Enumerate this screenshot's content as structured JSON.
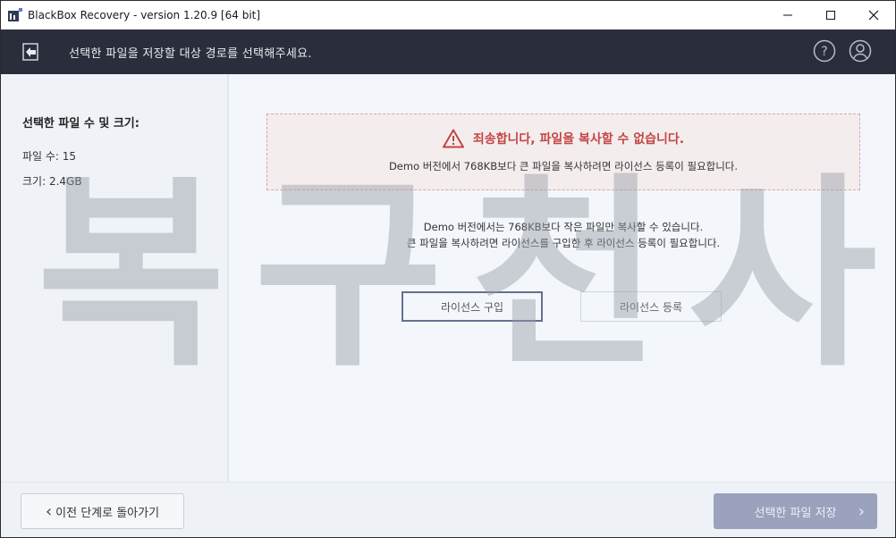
{
  "window": {
    "title": "BlackBox Recovery - version 1.20.9 [64 bit]"
  },
  "controls": {
    "minimize": "—",
    "maximize": "☐",
    "close": "✕"
  },
  "header": {
    "instruction": "선택한 파일을 저장할 대상 경로를 선택해주세요."
  },
  "left_panel": {
    "title": "선택한 파일 수 및 크기:",
    "file_count": "파일 수: 15",
    "size": "크기: 2.4GB"
  },
  "error": {
    "title": "죄송합니다, 파일을 복사할 수 없습니다.",
    "message": "Demo 버전에서 768KB보다 큰 파일을 복사하려면 라이선스 등록이 필요합니다."
  },
  "info": {
    "line1": "Demo 버전에서는 768KB보다 작은 파일만 복사할 수 있습니다.",
    "line2": "큰 파일을 복사하려면 라이선스를 구입한 후 라이선스 등록이 필요합니다."
  },
  "buttons": {
    "buy_license": "라이선스 구입",
    "register_license": "라이선스 등록",
    "back": "이전 단계로 돌아가기",
    "save": "선택한 파일 저장"
  },
  "watermark": [
    "복",
    "구",
    "천",
    "사"
  ],
  "colors": {
    "header_bg": "#2a2e3c",
    "error_text": "#c44545",
    "save_button": "#9aa2bd"
  },
  "icons": {
    "app": "app-logo-icon",
    "back": "back-arrow-icon",
    "help": "help-icon",
    "account": "user-icon",
    "warning": "warning-triangle-icon",
    "chevron_left": "chevron-left-icon",
    "chevron_right": "chevron-right-icon"
  }
}
